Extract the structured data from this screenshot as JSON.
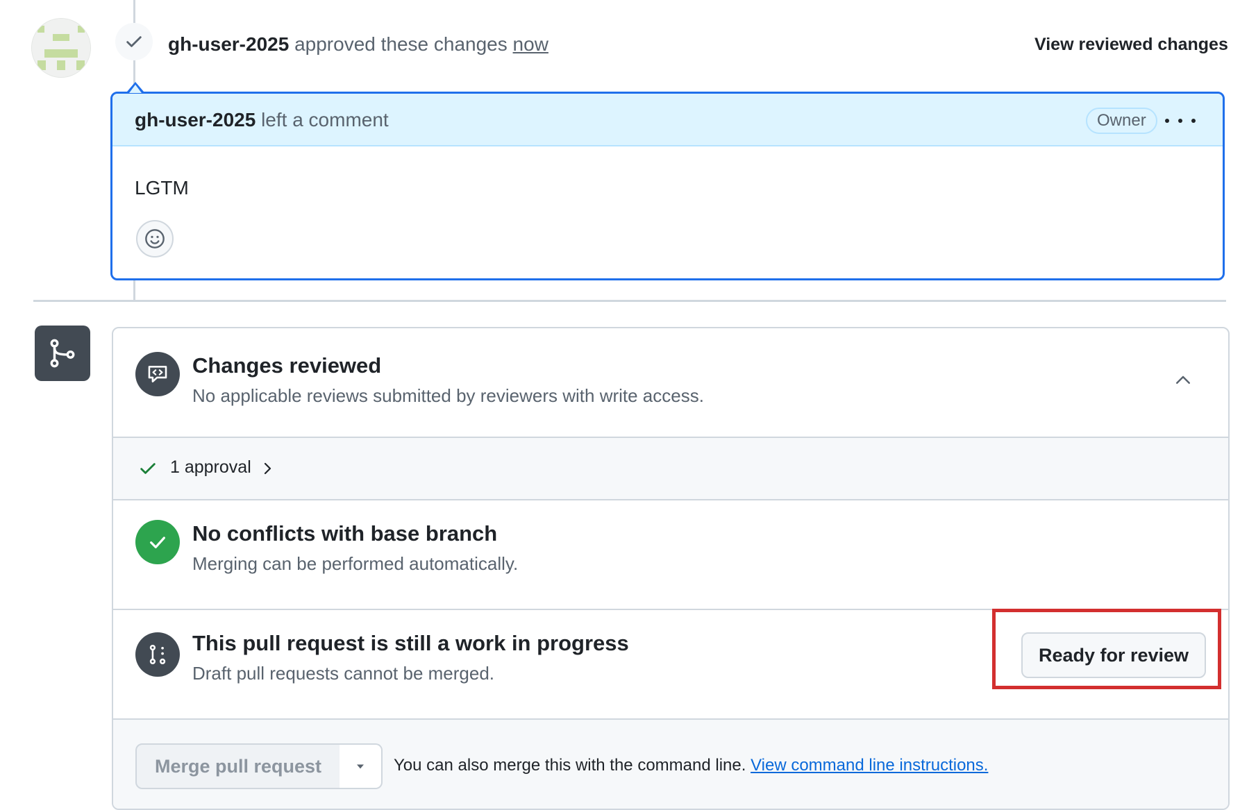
{
  "review": {
    "user": "gh-user-2025",
    "action": "approved these changes",
    "time": "now",
    "view_reviewed": "View reviewed changes"
  },
  "comment": {
    "user": "gh-user-2025",
    "action": "left a comment",
    "badge": "Owner",
    "body": "LGTM",
    "icons": [
      "smiley-icon",
      "kebab-horizontal-icon"
    ]
  },
  "merge_box": {
    "changes_reviewed": {
      "title": "Changes reviewed",
      "description": "No applicable reviews submitted by reviewers with write access."
    },
    "approval": {
      "label": "1 approval"
    },
    "conflicts": {
      "title": "No conflicts with base branch",
      "description": "Merging can be performed automatically."
    },
    "wip": {
      "title": "This pull request is still a work in progress",
      "description": "Draft pull requests cannot be merged.",
      "button": "Ready for review"
    },
    "merge": {
      "button": "Merge pull request",
      "hint": "You can also merge this with the command line.",
      "link": "View command line instructions."
    }
  },
  "colors": {
    "accent": "#1f6feb",
    "success": "#2da44e",
    "muted_icon": "#424a53",
    "highlight": "#d32f2f"
  }
}
